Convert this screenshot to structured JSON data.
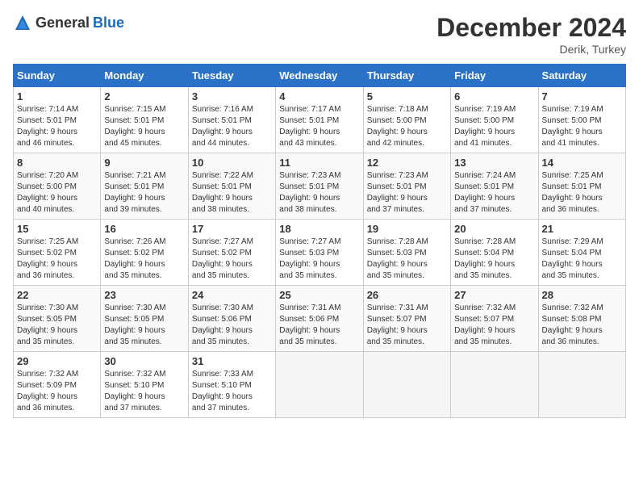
{
  "header": {
    "logo_general": "General",
    "logo_blue": "Blue",
    "month": "December 2024",
    "location": "Derik, Turkey"
  },
  "weekdays": [
    "Sunday",
    "Monday",
    "Tuesday",
    "Wednesday",
    "Thursday",
    "Friday",
    "Saturday"
  ],
  "weeks": [
    [
      {
        "day": 1,
        "info": "Sunrise: 7:14 AM\nSunset: 5:01 PM\nDaylight: 9 hours\nand 46 minutes."
      },
      {
        "day": 2,
        "info": "Sunrise: 7:15 AM\nSunset: 5:01 PM\nDaylight: 9 hours\nand 45 minutes."
      },
      {
        "day": 3,
        "info": "Sunrise: 7:16 AM\nSunset: 5:01 PM\nDaylight: 9 hours\nand 44 minutes."
      },
      {
        "day": 4,
        "info": "Sunrise: 7:17 AM\nSunset: 5:01 PM\nDaylight: 9 hours\nand 43 minutes."
      },
      {
        "day": 5,
        "info": "Sunrise: 7:18 AM\nSunset: 5:00 PM\nDaylight: 9 hours\nand 42 minutes."
      },
      {
        "day": 6,
        "info": "Sunrise: 7:19 AM\nSunset: 5:00 PM\nDaylight: 9 hours\nand 41 minutes."
      },
      {
        "day": 7,
        "info": "Sunrise: 7:19 AM\nSunset: 5:00 PM\nDaylight: 9 hours\nand 41 minutes."
      }
    ],
    [
      {
        "day": 8,
        "info": "Sunrise: 7:20 AM\nSunset: 5:00 PM\nDaylight: 9 hours\nand 40 minutes."
      },
      {
        "day": 9,
        "info": "Sunrise: 7:21 AM\nSunset: 5:01 PM\nDaylight: 9 hours\nand 39 minutes."
      },
      {
        "day": 10,
        "info": "Sunrise: 7:22 AM\nSunset: 5:01 PM\nDaylight: 9 hours\nand 38 minutes."
      },
      {
        "day": 11,
        "info": "Sunrise: 7:23 AM\nSunset: 5:01 PM\nDaylight: 9 hours\nand 38 minutes."
      },
      {
        "day": 12,
        "info": "Sunrise: 7:23 AM\nSunset: 5:01 PM\nDaylight: 9 hours\nand 37 minutes."
      },
      {
        "day": 13,
        "info": "Sunrise: 7:24 AM\nSunset: 5:01 PM\nDaylight: 9 hours\nand 37 minutes."
      },
      {
        "day": 14,
        "info": "Sunrise: 7:25 AM\nSunset: 5:01 PM\nDaylight: 9 hours\nand 36 minutes."
      }
    ],
    [
      {
        "day": 15,
        "info": "Sunrise: 7:25 AM\nSunset: 5:02 PM\nDaylight: 9 hours\nand 36 minutes."
      },
      {
        "day": 16,
        "info": "Sunrise: 7:26 AM\nSunset: 5:02 PM\nDaylight: 9 hours\nand 35 minutes."
      },
      {
        "day": 17,
        "info": "Sunrise: 7:27 AM\nSunset: 5:02 PM\nDaylight: 9 hours\nand 35 minutes."
      },
      {
        "day": 18,
        "info": "Sunrise: 7:27 AM\nSunset: 5:03 PM\nDaylight: 9 hours\nand 35 minutes."
      },
      {
        "day": 19,
        "info": "Sunrise: 7:28 AM\nSunset: 5:03 PM\nDaylight: 9 hours\nand 35 minutes."
      },
      {
        "day": 20,
        "info": "Sunrise: 7:28 AM\nSunset: 5:04 PM\nDaylight: 9 hours\nand 35 minutes."
      },
      {
        "day": 21,
        "info": "Sunrise: 7:29 AM\nSunset: 5:04 PM\nDaylight: 9 hours\nand 35 minutes."
      }
    ],
    [
      {
        "day": 22,
        "info": "Sunrise: 7:30 AM\nSunset: 5:05 PM\nDaylight: 9 hours\nand 35 minutes."
      },
      {
        "day": 23,
        "info": "Sunrise: 7:30 AM\nSunset: 5:05 PM\nDaylight: 9 hours\nand 35 minutes."
      },
      {
        "day": 24,
        "info": "Sunrise: 7:30 AM\nSunset: 5:06 PM\nDaylight: 9 hours\nand 35 minutes."
      },
      {
        "day": 25,
        "info": "Sunrise: 7:31 AM\nSunset: 5:06 PM\nDaylight: 9 hours\nand 35 minutes."
      },
      {
        "day": 26,
        "info": "Sunrise: 7:31 AM\nSunset: 5:07 PM\nDaylight: 9 hours\nand 35 minutes."
      },
      {
        "day": 27,
        "info": "Sunrise: 7:32 AM\nSunset: 5:07 PM\nDaylight: 9 hours\nand 35 minutes."
      },
      {
        "day": 28,
        "info": "Sunrise: 7:32 AM\nSunset: 5:08 PM\nDaylight: 9 hours\nand 36 minutes."
      }
    ],
    [
      {
        "day": 29,
        "info": "Sunrise: 7:32 AM\nSunset: 5:09 PM\nDaylight: 9 hours\nand 36 minutes."
      },
      {
        "day": 30,
        "info": "Sunrise: 7:32 AM\nSunset: 5:10 PM\nDaylight: 9 hours\nand 37 minutes."
      },
      {
        "day": 31,
        "info": "Sunrise: 7:33 AM\nSunset: 5:10 PM\nDaylight: 9 hours\nand 37 minutes."
      },
      null,
      null,
      null,
      null
    ]
  ]
}
